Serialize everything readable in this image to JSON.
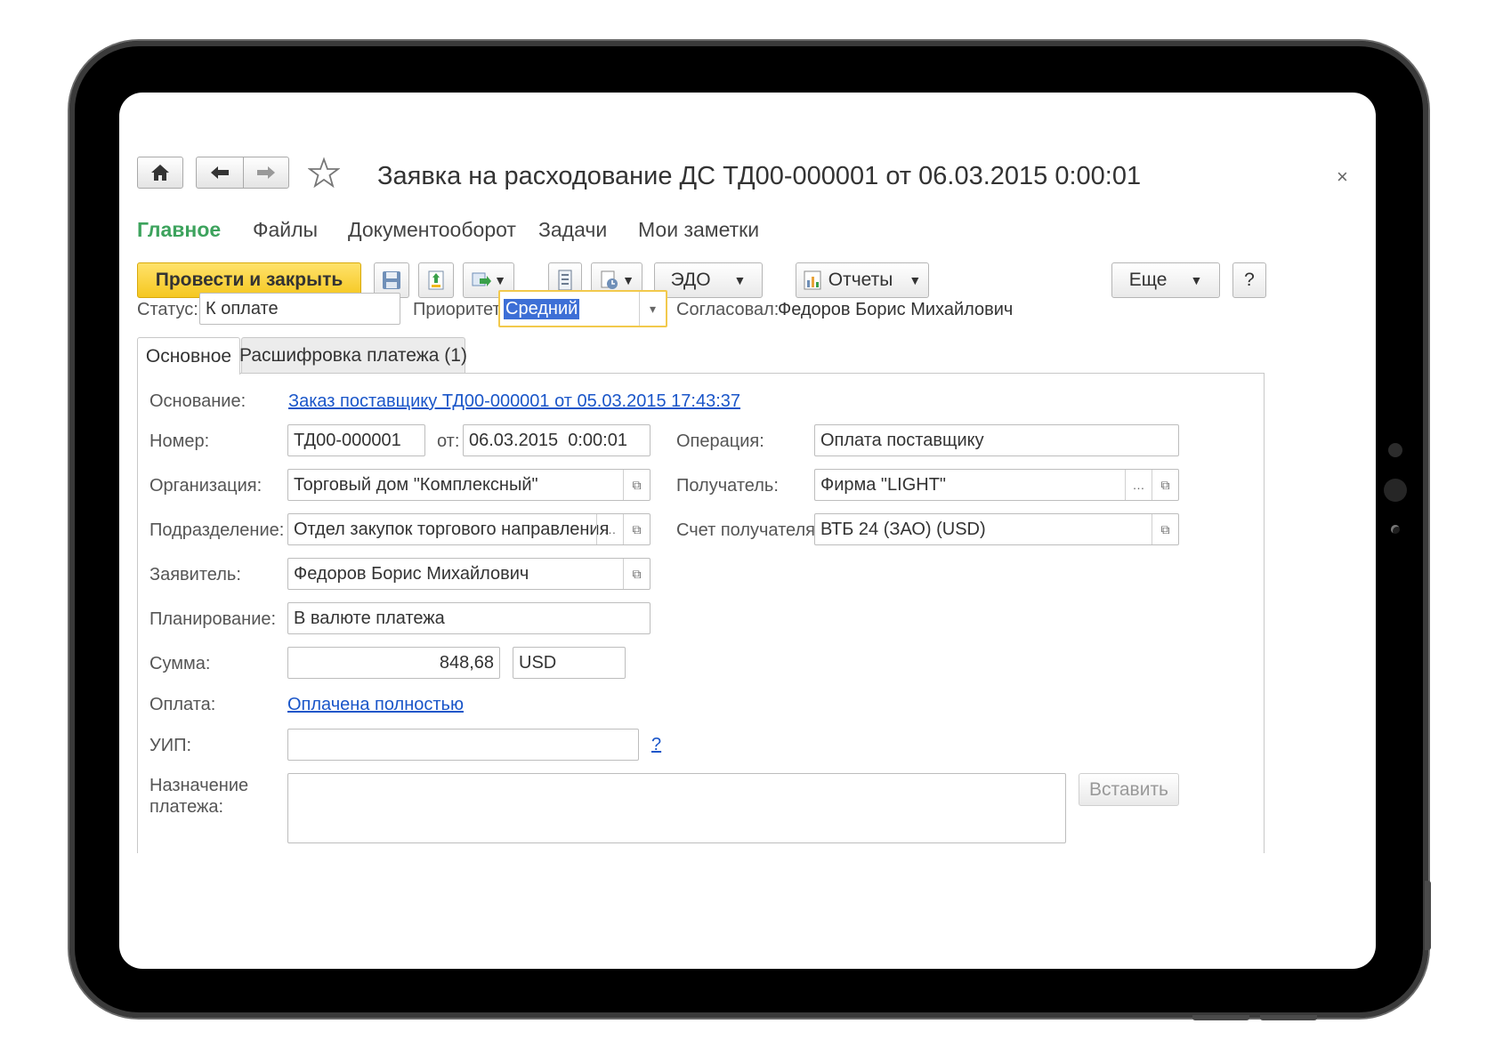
{
  "window": {
    "title": "Заявка на расходование ДС ТД00-000001 от 06.03.2015 0:00:01",
    "close_icon": "×",
    "home_icon": "🏠",
    "back_icon": "🡐",
    "forward_icon": "🡒",
    "favorite_icon": "☆"
  },
  "menu": {
    "items": [
      "Главное",
      "Файлы",
      "Документооборот",
      "Задачи",
      "Мои заметки"
    ],
    "active_color": "#3da35d"
  },
  "toolbar": {
    "post_close_label": "Провести и закрыть",
    "edo_label": "ЭДО",
    "reports_label": "Отчеты",
    "more_label": "Еще",
    "help_label": "?"
  },
  "header": {
    "status_label": "Статус:",
    "status_value": "К оплате",
    "priority_label": "Приоритет:",
    "priority_value": "Средний",
    "approved_label": "Согласовал:",
    "approved_value": "Федоров Борис Михайлович"
  },
  "tabs": [
    "Основное",
    "Расшифровка платежа (1)"
  ],
  "form": {
    "basis_label": "Основание:",
    "basis_link": "Заказ поставщику ТД00-000001 от 05.03.2015 17:43:37",
    "number_label": "Номер:",
    "number_value": "ТД00-000001",
    "date_label": "от:",
    "date_value": "06.03.2015  0:00:01",
    "operation_label": "Операция:",
    "operation_value": "Оплата поставщику",
    "org_label": "Организация:",
    "org_value": "Торговый дом \"Комплексный\"",
    "recipient_label": "Получатель:",
    "recipient_value": "Фирма \"LIGHT\"",
    "dept_label": "Подразделение:",
    "dept_value": "Отдел закупок торгового направления",
    "account_label": "Счет получателя:",
    "account_value": "ВТБ 24 (ЗАО) (USD)",
    "applicant_label": "Заявитель:",
    "applicant_value": "Федоров Борис Михайлович",
    "planning_label": "Планирование:",
    "planning_value": "В валюте платежа",
    "sum_label": "Сумма:",
    "sum_value": "848,68",
    "currency_value": "USD",
    "payment_label": "Оплата:",
    "payment_link": "Оплачена полностью",
    "uip_label": "УИП:",
    "uip_value": "",
    "uip_help": "?",
    "purpose_label_1": "Назначение",
    "purpose_label_2": "платежа:",
    "purpose_value": "",
    "insert_label": "Вставить"
  }
}
